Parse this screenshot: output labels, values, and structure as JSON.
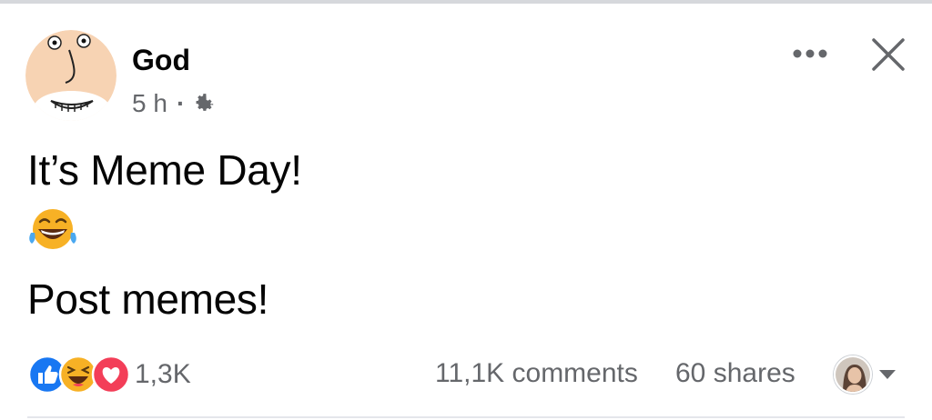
{
  "post": {
    "author": "God",
    "time": "5 h",
    "separator": "·",
    "privacy_icon": "gear-icon",
    "lines": [
      "It’s Meme Day!",
      "😂",
      "Post memes!"
    ],
    "emoji_icon": "face-with-tears-of-joy-icon"
  },
  "header_actions": {
    "more_icon": "more-dots-icon",
    "close_icon": "close-icon"
  },
  "footer": {
    "reaction_icons": [
      "like-icon",
      "haha-icon",
      "love-icon"
    ],
    "reaction_count": "1,3K",
    "comments": "11,1K comments",
    "shares": "60 shares",
    "viewer_icon": "viewer-avatar",
    "dropdown_icon": "caret-down-icon"
  },
  "colors": {
    "text": "#050505",
    "secondary_text": "#65676b",
    "like_blue": "#1877f2",
    "love_red": "#f33e58",
    "haha_yellow": "#f7b125"
  }
}
